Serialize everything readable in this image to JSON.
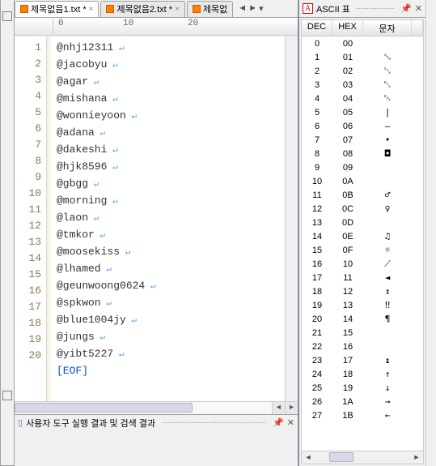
{
  "tabs": [
    {
      "label": "제목없음1.txt *",
      "active": true
    },
    {
      "label": "제목없음2.txt *",
      "active": false
    },
    {
      "label": "제목없",
      "active": false
    }
  ],
  "ruler": [
    "0",
    "10",
    "20"
  ],
  "lines": [
    "@nhj12311",
    "@jacobyu",
    "@agar",
    "@mishana",
    "@wonnieyoon",
    "@adana",
    "@dakeshi",
    "@hjk8596",
    "@gbgg",
    "@morning",
    "@laon",
    "@tmkor",
    "@moosekiss",
    "@lhamed",
    "@geunwoong0624",
    "@spkwon",
    "@blue1004jy",
    "@jungs",
    "@yibt5227"
  ],
  "eof_label": "[EOF]",
  "status_label": "사용자 도구 실행 결과 및 검색 결과",
  "ascii_title": "ASCII 표",
  "ascii_headers": {
    "dec": "DEC",
    "hex": "HEX",
    "chr": "문자"
  },
  "ascii_rows": [
    {
      "dec": "0",
      "hex": "00",
      "chr": ""
    },
    {
      "dec": "1",
      "hex": "01",
      "chr": "␁"
    },
    {
      "dec": "2",
      "hex": "02",
      "chr": "␂"
    },
    {
      "dec": "3",
      "hex": "03",
      "chr": "␃"
    },
    {
      "dec": "4",
      "hex": "04",
      "chr": "␄"
    },
    {
      "dec": "5",
      "hex": "05",
      "chr": "|"
    },
    {
      "dec": "6",
      "hex": "06",
      "chr": "–"
    },
    {
      "dec": "7",
      "hex": "07",
      "chr": "•"
    },
    {
      "dec": "8",
      "hex": "08",
      "chr": "◘"
    },
    {
      "dec": "9",
      "hex": "09",
      "chr": ""
    },
    {
      "dec": "10",
      "hex": "0A",
      "chr": ""
    },
    {
      "dec": "11",
      "hex": "0B",
      "chr": "♂"
    },
    {
      "dec": "12",
      "hex": "0C",
      "chr": "♀"
    },
    {
      "dec": "13",
      "hex": "0D",
      "chr": ""
    },
    {
      "dec": "14",
      "hex": "0E",
      "chr": "♫"
    },
    {
      "dec": "15",
      "hex": "0F",
      "chr": "☼"
    },
    {
      "dec": "16",
      "hex": "10",
      "chr": "⟋"
    },
    {
      "dec": "17",
      "hex": "11",
      "chr": "◄"
    },
    {
      "dec": "18",
      "hex": "12",
      "chr": "↕"
    },
    {
      "dec": "19",
      "hex": "13",
      "chr": "‼"
    },
    {
      "dec": "20",
      "hex": "14",
      "chr": "¶"
    },
    {
      "dec": "21",
      "hex": "15",
      "chr": ""
    },
    {
      "dec": "22",
      "hex": "16",
      "chr": ""
    },
    {
      "dec": "23",
      "hex": "17",
      "chr": "↨"
    },
    {
      "dec": "24",
      "hex": "18",
      "chr": "↑"
    },
    {
      "dec": "25",
      "hex": "19",
      "chr": "↓"
    },
    {
      "dec": "26",
      "hex": "1A",
      "chr": "→"
    },
    {
      "dec": "27",
      "hex": "1B",
      "chr": "←"
    }
  ]
}
